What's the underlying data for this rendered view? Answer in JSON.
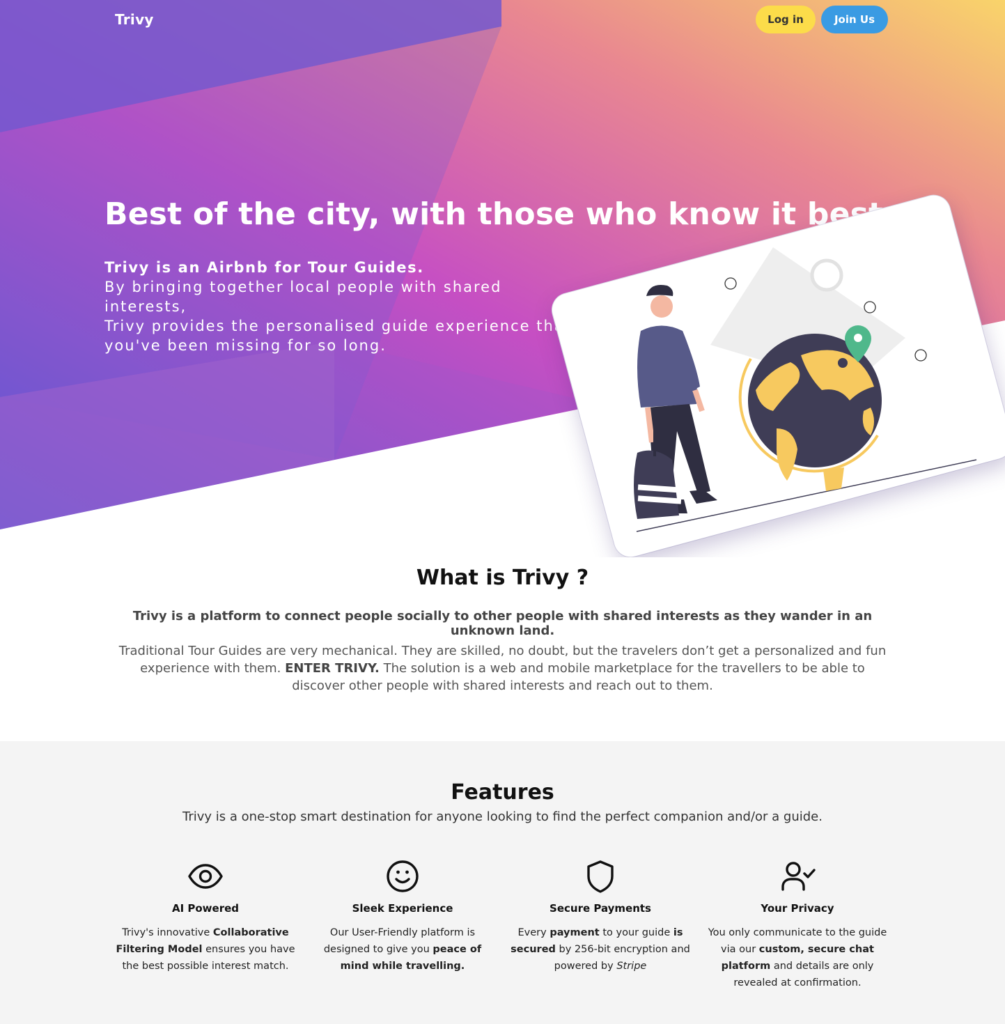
{
  "nav": {
    "brand": "Trivy",
    "login_label": "Log in",
    "join_label": "Join Us"
  },
  "hero": {
    "title": "Best of the city, with those who know it best.",
    "subtitle_bold": "Trivy is an Airbnb for Tour Guides.",
    "subtitle_line1": "By bringing together local people with shared interests,",
    "subtitle_line2": "Trivy provides the personalised guide experience that",
    "subtitle_line3": "you've been missing for so long."
  },
  "what": {
    "heading": "What is Trivy ?",
    "lead": "Trivy is a platform to connect people socially to other people with shared interests as they wander in an unknown land.",
    "desc_part1": "Traditional Tour Guides are very mechanical. They are skilled, no doubt, but the travelers don’t get a personalized and fun experience with them.",
    "desc_bold": "ENTER TRIVY.",
    "desc_part2": "The solution is a web and mobile marketplace for the travellers to be able to discover other people with shared interests and reach out to them."
  },
  "features": {
    "heading": "Features",
    "subtitle": "Trivy is a one-stop smart destination for anyone looking to find the perfect companion and/or a guide.",
    "items": [
      {
        "icon": "eye-icon",
        "title": "AI Powered",
        "t1": "Trivy's innovative ",
        "b1": "Collaborative Filtering Model",
        "t2": " ensures you have the best possible interest match."
      },
      {
        "icon": "smile-icon",
        "title": "Sleek Experience",
        "t1": "Our User-Friendly platform is designed to give you ",
        "b1": "peace of mind while travelling."
      },
      {
        "icon": "shield-icon",
        "title": "Secure Payments",
        "t1": "Every ",
        "b1": "payment",
        "t2": " to your guide ",
        "b2": "is secured",
        "t3": " by 256-bit encryption and powered by ",
        "i1": "Stripe"
      },
      {
        "icon": "user-check-icon",
        "title": "Your Privacy",
        "t1": "You only communicate to the guide via our ",
        "b1": "custom, secure chat platform",
        "t2": " and details are only revealed at confirmation."
      }
    ]
  },
  "colors": {
    "login_button": "#fcdc4a",
    "join_button": "#3a9be3",
    "gradient": [
      "#5a55d6",
      "#c94fc2",
      "#f7ce68"
    ]
  }
}
